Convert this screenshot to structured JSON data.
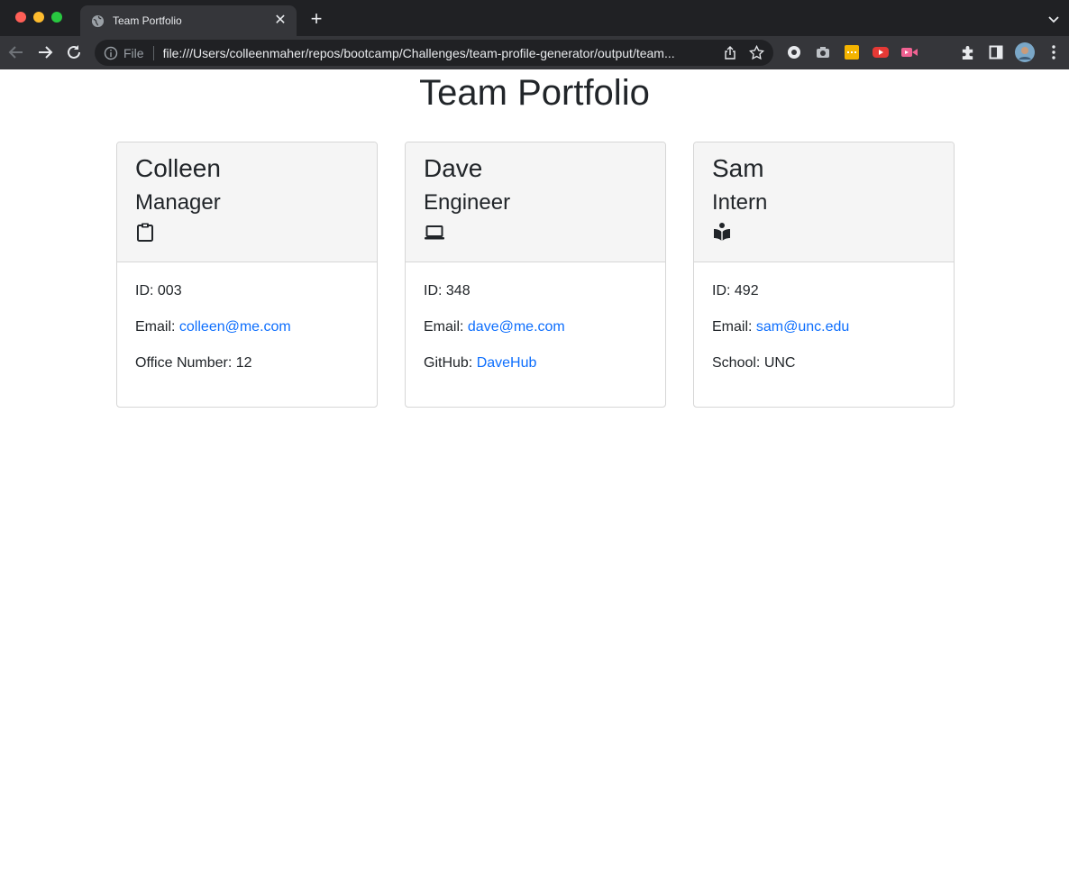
{
  "browser": {
    "tab_title": "Team Portfolio",
    "url_scheme": "File",
    "url": "file:///Users/colleenmaher/repos/bootcamp/Challenges/team-profile-generator/output/team...",
    "colors": {
      "frame": "#202124",
      "toolbar": "#35363a",
      "omnibox": "#202124"
    },
    "icons": [
      "back-icon",
      "forward-icon",
      "reload-icon",
      "info-icon",
      "share-icon",
      "star-icon",
      "extensions-icon",
      "side-panel-icon",
      "profile-avatar",
      "more-icon"
    ]
  },
  "page": {
    "title": "Team Portfolio",
    "link_color": "#0d6efd",
    "cards": [
      {
        "name": "Colleen",
        "role": "Manager",
        "icon": "clipboard-icon",
        "id_label": "ID: ",
        "id": "003",
        "email_label": "Email: ",
        "email": "colleen@me.com",
        "extra_label": "Office Number: ",
        "extra_value": "12"
      },
      {
        "name": "Dave",
        "role": "Engineer",
        "icon": "laptop-icon",
        "id_label": "ID: ",
        "id": "348",
        "email_label": "Email: ",
        "email": "dave@me.com",
        "extra_label": "GitHub: ",
        "extra_value": "DaveHub"
      },
      {
        "name": "Sam",
        "role": "Intern",
        "icon": "book-reader-icon",
        "id_label": "ID: ",
        "id": "492",
        "email_label": "Email: ",
        "email": "sam@unc.edu",
        "extra_label": "School: ",
        "extra_value": "UNC"
      }
    ]
  }
}
